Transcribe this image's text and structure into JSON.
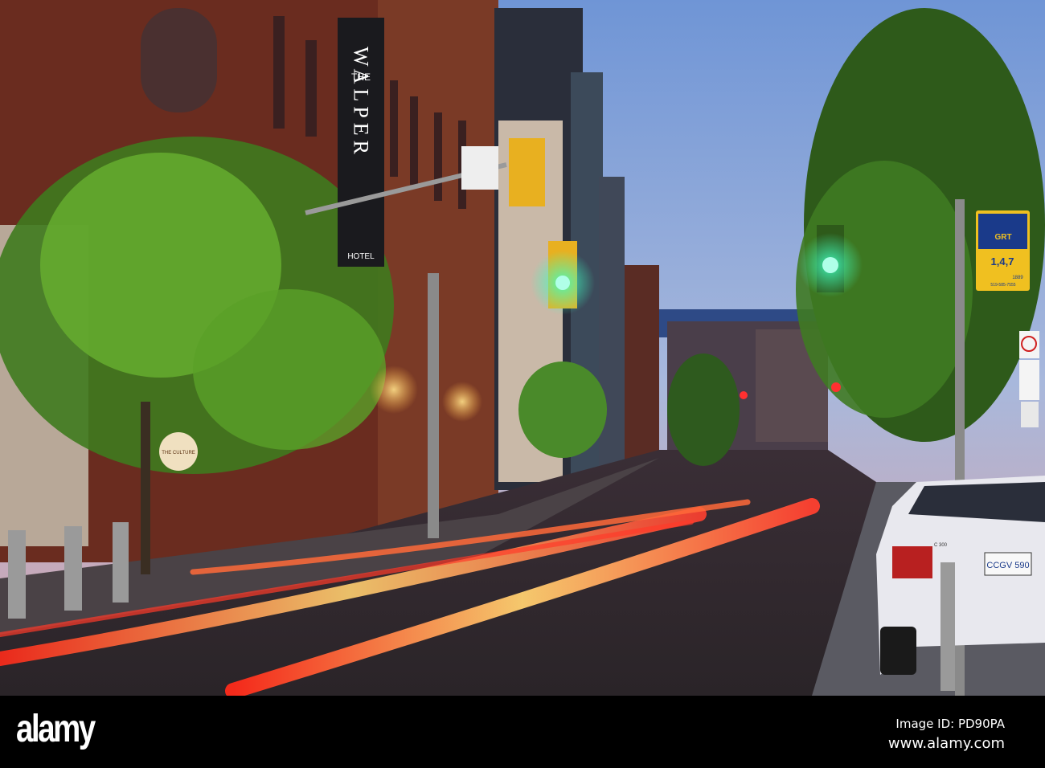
{
  "photo": {
    "hotel_sign": {
      "line1": "THE",
      "line2": "WALPER",
      "line3": "HOTEL"
    },
    "bus_stop_sign": {
      "brand": "GRT",
      "routes": "1,4,7",
      "phone_code": "1889",
      "phone": "519-585-7555"
    },
    "license_plate": "CCGV 590",
    "car_badge": "C 300",
    "storefront_sign": "THE CULTURE",
    "colors": {
      "sky_top": "#6f95d6",
      "sky_bottom": "#c9a9b8",
      "signal_green": "#22ffb0",
      "trail_red": "#ff3a2a",
      "trail_yellow": "#ffd070",
      "brick": "#6a2c1f"
    }
  },
  "watermark": {
    "logo": "alamy",
    "image_id": "Image ID: PD90PA",
    "website": "www.alamy.com"
  }
}
